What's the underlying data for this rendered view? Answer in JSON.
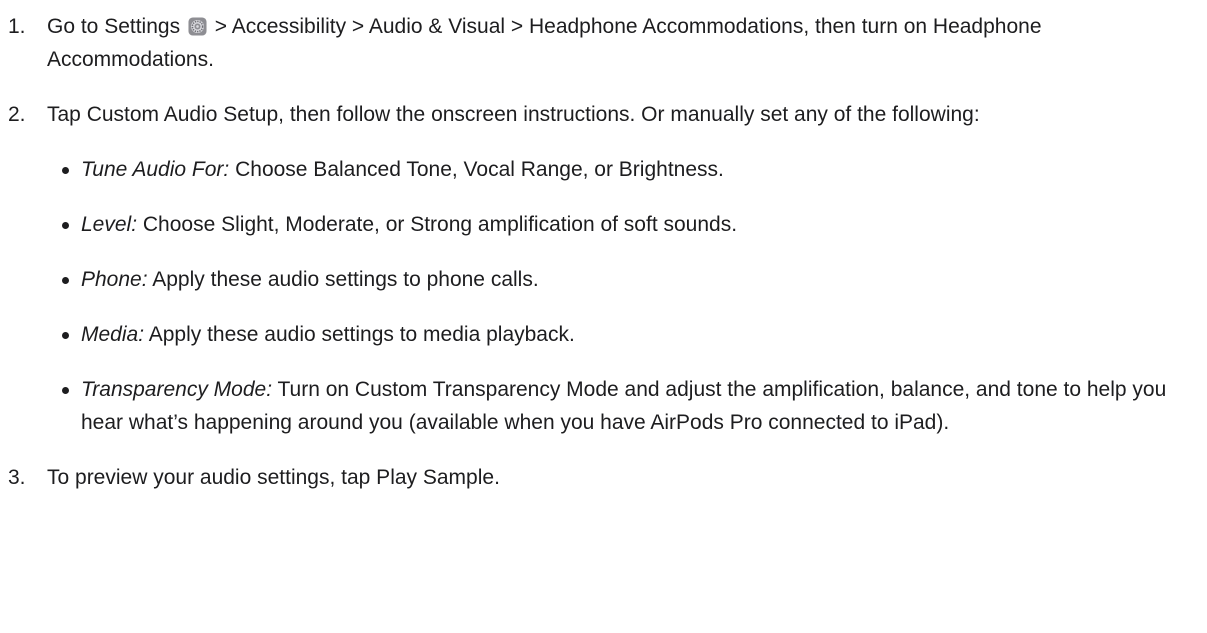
{
  "steps": [
    {
      "number": "1.",
      "text_before_icon": "Go to Settings",
      "icon": "settings-gear-icon",
      "text_after_icon": "> Accessibility > Audio & Visual > Headphone Accommodations, then turn on Headphone Accommodations."
    },
    {
      "number": "2.",
      "text": "Tap Custom Audio Setup, then follow the onscreen instructions. Or manually set any of the following:",
      "bullets": [
        {
          "term": "Tune Audio For:",
          "text": "Choose Balanced Tone, Vocal Range, or Brightness."
        },
        {
          "term": "Level:",
          "text": "Choose Slight, Moderate, or Strong amplification of soft sounds."
        },
        {
          "term": "Phone:",
          "text": "Apply these audio settings to phone calls."
        },
        {
          "term": "Media:",
          "text": "Apply these audio settings to media playback."
        },
        {
          "term": "Transparency Mode:",
          "text": "Turn on Custom Transparency Mode and adjust the amplification, balance, and tone to help you hear what’s happening around you (available when you have AirPods Pro connected to iPad)."
        }
      ]
    },
    {
      "number": "3.",
      "text": "To preview your audio settings, tap Play Sample."
    }
  ]
}
